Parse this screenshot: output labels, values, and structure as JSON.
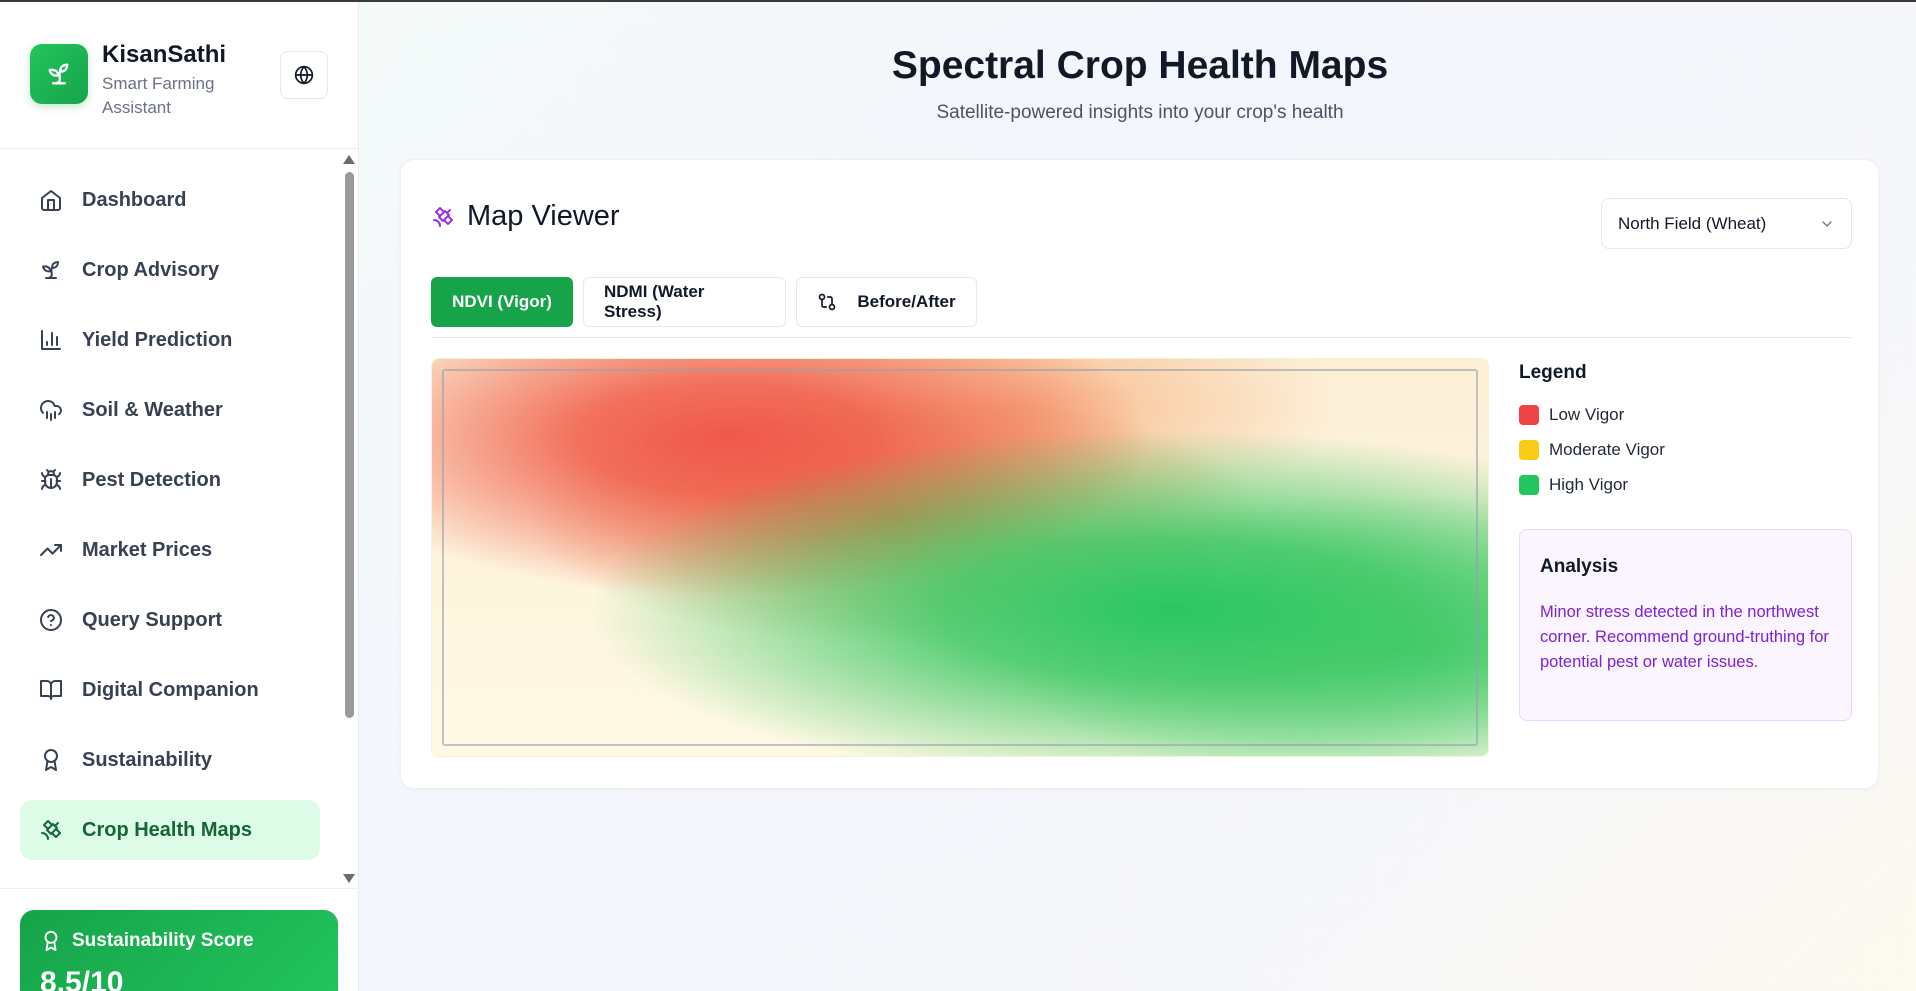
{
  "brand": {
    "name": "KisanSathi",
    "subtitle": "Smart Farming Assistant"
  },
  "sidebar": {
    "items": [
      {
        "label": "Dashboard",
        "icon": "home-icon"
      },
      {
        "label": "Crop Advisory",
        "icon": "sprout-icon"
      },
      {
        "label": "Yield Prediction",
        "icon": "bar-chart-icon"
      },
      {
        "label": "Soil & Weather",
        "icon": "cloud-rain-icon"
      },
      {
        "label": "Pest Detection",
        "icon": "bug-icon"
      },
      {
        "label": "Market Prices",
        "icon": "trending-up-icon"
      },
      {
        "label": "Query Support",
        "icon": "help-circle-icon"
      },
      {
        "label": "Digital Companion",
        "icon": "book-open-icon"
      },
      {
        "label": "Sustainability",
        "icon": "award-icon"
      },
      {
        "label": "Crop Health Maps",
        "icon": "satellite-icon",
        "active": true
      }
    ],
    "score": {
      "title": "Sustainability Score",
      "value": "8.5/10"
    }
  },
  "page": {
    "title": "Spectral Crop Health Maps",
    "subtitle": "Satellite-powered insights into your crop's health"
  },
  "viewer": {
    "title": "Map Viewer",
    "field_select": "North Field (Wheat)",
    "tabs": [
      {
        "label": "NDVI (Vigor)",
        "active": true
      },
      {
        "label": "NDMI (Water Stress)",
        "active": false
      },
      {
        "label": "Before/After",
        "active": false,
        "icon": "compare-arrows-icon"
      }
    ],
    "legend": {
      "title": "Legend",
      "items": [
        {
          "label": "Low Vigor",
          "color": "#ef4444"
        },
        {
          "label": "Moderate Vigor",
          "color": "#facc15"
        },
        {
          "label": "High Vigor",
          "color": "#22c55e"
        }
      ]
    },
    "analysis": {
      "title": "Analysis",
      "text": "Minor stress detected in the northwest corner. Recommend ground-truthing for potential pest or water issues."
    }
  },
  "colors": {
    "brand_green": "#16a34a",
    "active_nav_bg": "#dcfce7",
    "analysis_text": "#7e22ce"
  }
}
